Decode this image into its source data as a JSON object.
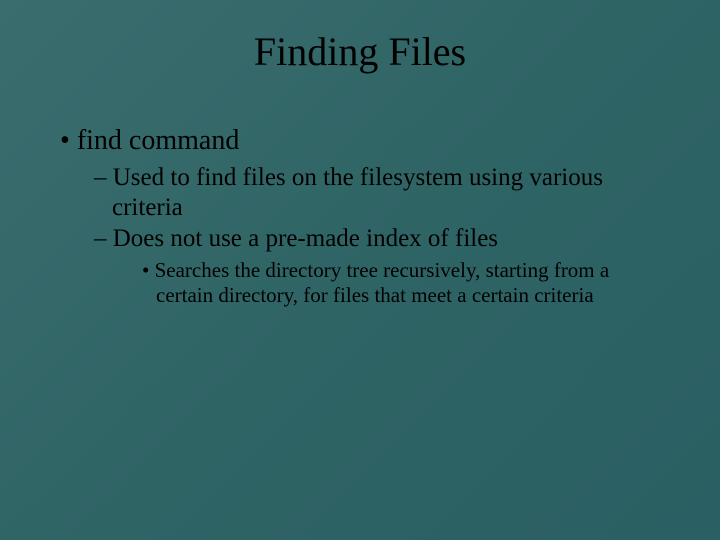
{
  "slide": {
    "title": "Finding Files",
    "bullets": [
      {
        "text": "find command",
        "children": [
          {
            "text": "Used to find files on the filesystem using various criteria"
          },
          {
            "text": "Does not use a pre-made index of files",
            "children": [
              {
                "text": "Searches the directory tree recursively, starting from a certain directory, for files that meet a certain criteria"
              }
            ]
          }
        ]
      }
    ]
  }
}
